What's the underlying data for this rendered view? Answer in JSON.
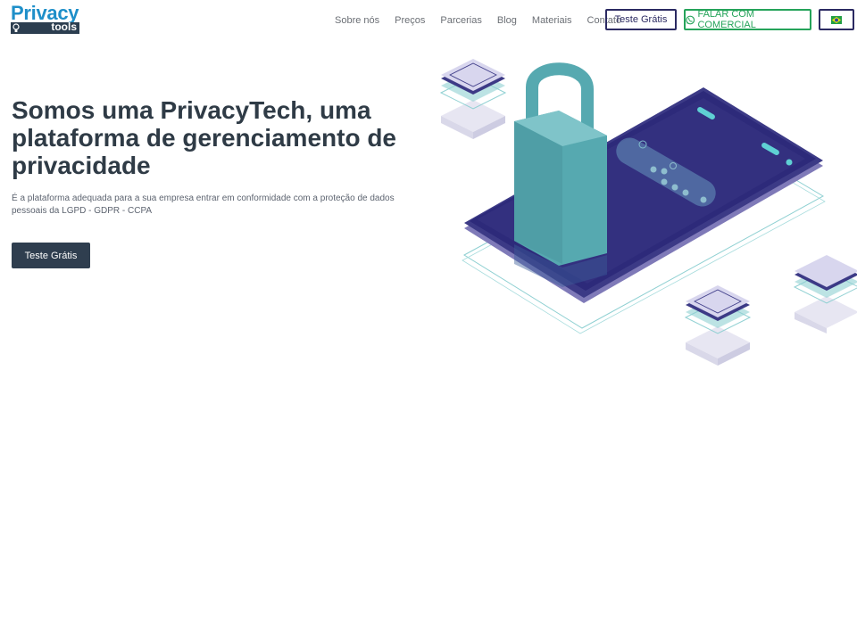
{
  "brand": {
    "logo_top": "Privacy",
    "logo_bottom": "tools"
  },
  "nav": {
    "items": [
      "Sobre nós",
      "Preços",
      "Parcerias",
      "Blog",
      "Materiais",
      "Contato"
    ],
    "trial_button": "Teste Grátis",
    "sales_button": "FALAR COM COMERCIAL",
    "sales_icon": "whatsapp-icon",
    "language_icon": "brazil-flag-icon"
  },
  "hero": {
    "title": "Somos uma PrivacyTech, uma plataforma de gerenciamento de privacidade",
    "subtitle": "É a plataforma adequada para a sua empresa entrar em conformidade com a proteção de dados pessoais da LGPD - GDPR - CCPA",
    "cta": "Teste Grátis",
    "illustration_icon": "padlock-phone-illustration"
  },
  "colors": {
    "brand_blue": "#1e8fc9",
    "dark_navy": "#2b2a62",
    "whatsapp_green": "#25a35a",
    "cta_dark": "#2f3e4f",
    "teal": "#56a9b0"
  }
}
